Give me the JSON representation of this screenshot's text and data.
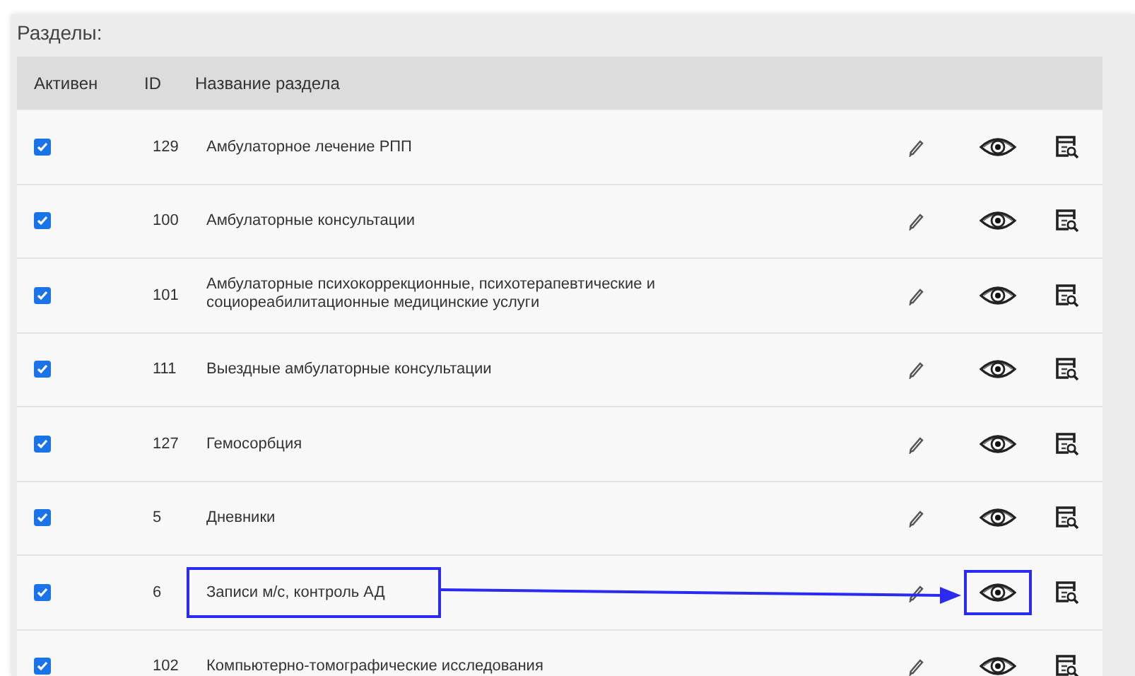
{
  "title": "Разделы:",
  "columns": [
    "Активен",
    "ID",
    "Название раздела"
  ],
  "rows": [
    {
      "active": true,
      "id": "129",
      "name": "Амбулаторное лечение РПП",
      "highlighted": false
    },
    {
      "active": true,
      "id": "100",
      "name": "Амбулаторные консультации",
      "highlighted": false
    },
    {
      "active": true,
      "id": "101",
      "name": "Амбулаторные психокоррекционные, психотерапевтические и социореабилитационные медицинские услуги",
      "highlighted": false
    },
    {
      "active": true,
      "id": "111",
      "name": "Выездные амбулаторные консультации",
      "highlighted": false
    },
    {
      "active": true,
      "id": "127",
      "name": "Гемосорбция",
      "highlighted": false
    },
    {
      "active": true,
      "id": "5",
      "name": "Дневники",
      "highlighted": false
    },
    {
      "active": true,
      "id": "6",
      "name": "Записи м/с, контроль АД",
      "highlighted": true
    },
    {
      "active": true,
      "id": "102",
      "name": "Компьютерно-томографические исследования",
      "highlighted": false
    }
  ]
}
